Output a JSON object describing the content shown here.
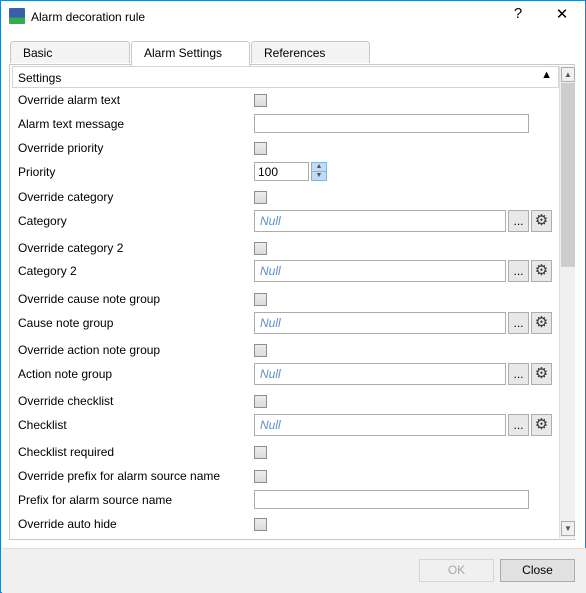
{
  "window": {
    "title": "Alarm decoration rule",
    "help": "?",
    "close": "✕"
  },
  "tabs": [
    {
      "label": "Basic"
    },
    {
      "label": "Alarm Settings"
    },
    {
      "label": "References"
    }
  ],
  "section": {
    "title": "Settings"
  },
  "rows": [
    {
      "label": "Override alarm text",
      "type": "checkbox",
      "checked": false
    },
    {
      "label": "Alarm text message",
      "type": "text",
      "value": ""
    },
    {
      "label": "Override priority",
      "type": "checkbox",
      "checked": false
    },
    {
      "label": "Priority",
      "type": "spin",
      "value": "100"
    },
    {
      "label": "Override category",
      "type": "checkbox",
      "checked": false
    },
    {
      "label": "Category",
      "type": "ref",
      "value": "Null"
    },
    {
      "label": "Override category 2",
      "type": "checkbox",
      "checked": false
    },
    {
      "label": "Category 2",
      "type": "ref",
      "value": "Null"
    },
    {
      "label": "Override cause note group",
      "type": "checkbox",
      "checked": false
    },
    {
      "label": "Cause note group",
      "type": "ref",
      "value": "Null"
    },
    {
      "label": "Override action note group",
      "type": "checkbox",
      "checked": false
    },
    {
      "label": "Action note group",
      "type": "ref",
      "value": "Null"
    },
    {
      "label": "Override checklist",
      "type": "checkbox",
      "checked": false
    },
    {
      "label": "Checklist",
      "type": "ref",
      "value": "Null"
    },
    {
      "label": "Checklist required",
      "type": "checkbox",
      "checked": false
    },
    {
      "label": "Override prefix for alarm source name",
      "type": "checkbox",
      "checked": false
    },
    {
      "label": "Prefix for alarm source name",
      "type": "text",
      "value": ""
    },
    {
      "label": "Override auto hide",
      "type": "checkbox",
      "checked": false
    }
  ],
  "ref_browse_label": "...",
  "footer": {
    "ok": "OK",
    "close": "Close"
  },
  "colors": {
    "window_border": "#1883d7",
    "null_text": "#5b8fd0"
  }
}
